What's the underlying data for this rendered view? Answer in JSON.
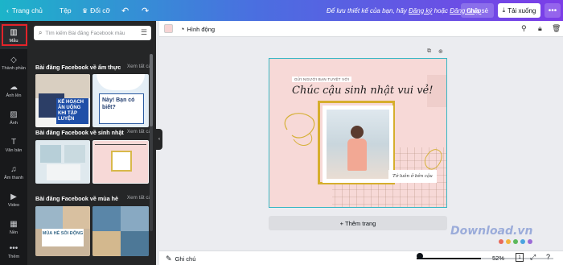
{
  "topbar": {
    "home": "Trang chủ",
    "file": "Tệp",
    "resize": "Đổi cỡ",
    "message_prefix": "Để lưu thiết kế của bạn, hãy",
    "register": "Đăng ký",
    "or": "hoặc",
    "login": "Đăng nhập",
    "share": "Chia sẻ",
    "download": "Tải xuống"
  },
  "rail": {
    "items": [
      {
        "label": "Mẫu",
        "icon": "template-icon"
      },
      {
        "label": "Thành phần",
        "icon": "elements-icon"
      },
      {
        "label": "Ảnh lên",
        "icon": "upload-icon"
      },
      {
        "label": "Ảnh",
        "icon": "photo-icon"
      },
      {
        "label": "Văn bản",
        "icon": "text-icon"
      },
      {
        "label": "Âm thanh",
        "icon": "audio-icon"
      },
      {
        "label": "Video",
        "icon": "video-icon"
      },
      {
        "label": "Nền",
        "icon": "background-icon"
      },
      {
        "label": "Thêm",
        "icon": "more-icon"
      }
    ]
  },
  "panel": {
    "search_placeholder": "Tìm kiếm Bài đăng Facebook mẫu",
    "see_all": "Xem tất cả",
    "sections": [
      {
        "title": "Bài đăng Facebook về ẩm thực"
      },
      {
        "title": "Bài đăng Facebook về sinh nhật"
      },
      {
        "title": "Bài đăng Facebook về mùa hè"
      }
    ],
    "thumb_texts": {
      "food1": "KẾ HOẠCH ĂN UỐNG KHI TẬP LUYỆN",
      "food2": "Này! Bạn có biết?",
      "summer1": "MÙA HÈ SÔI ĐỘNG"
    }
  },
  "editor": {
    "animate": "Hình động"
  },
  "design": {
    "tag": "GỬI NGƯỜI BẠN TUYỆT VỜI",
    "headline": "Chúc cậu sinh nhật vui vẻ!",
    "caption": "Tớ luôn ở bên cậu"
  },
  "canvas": {
    "add_page": "+ Thêm trang"
  },
  "footer": {
    "notes": "Ghi chú",
    "zoom": "52%",
    "page": "1"
  },
  "watermark": "Download.vn"
}
